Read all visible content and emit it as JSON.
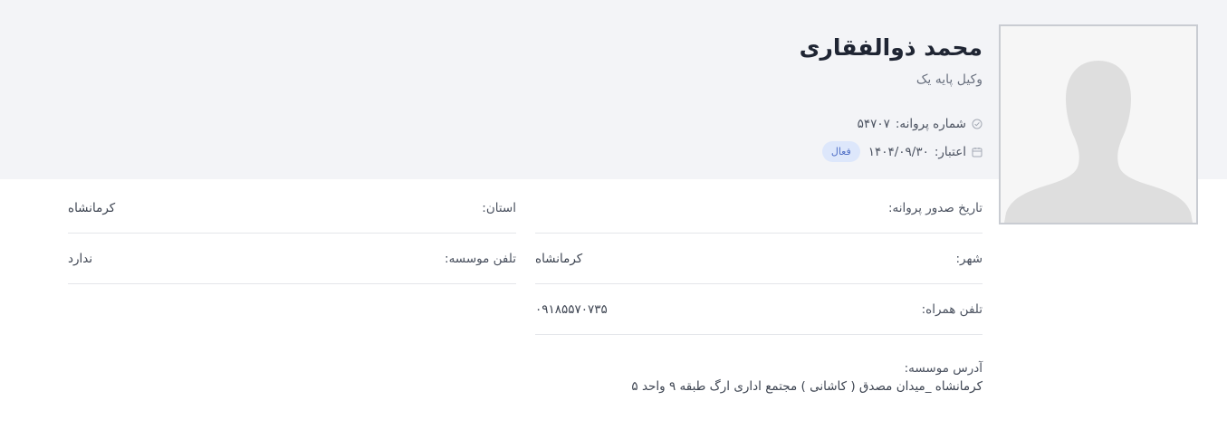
{
  "profile": {
    "name": "محمد ذوالفقاری",
    "title": "وکیل پایه یک",
    "license_label": "شماره پروانه:",
    "license_number": "۵۴۷۰۷",
    "validity_label": "اعتبار:",
    "validity_date": "۱۴۰۴/۰۹/۳۰",
    "status_badge": "فعال"
  },
  "fields": {
    "issue_date": {
      "label": "تاریخ صدور پروانه:",
      "value": ""
    },
    "province": {
      "label": "استان:",
      "value": "کرمانشاه"
    },
    "city": {
      "label": "شهر:",
      "value": "کرمانشاه"
    },
    "institute_phone": {
      "label": "تلفن موسسه:",
      "value": "ندارد"
    },
    "mobile": {
      "label": "تلفن همراه:",
      "value": "۰۹۱۸۵۵۷۰۷۳۵"
    },
    "institute_address": {
      "label": "آدرس موسسه:",
      "value": "کرمانشاه _میدان مصدق ( کاشانی ) مجتمع اداری ارگ طبقه ۹ واحد ۵"
    }
  },
  "icons": {
    "license": "check-circle-icon",
    "validity": "calendar-icon",
    "avatar": "person-silhouette-icon"
  },
  "colors": {
    "header_background": "#f3f4f7",
    "badge_background": "#dde7fb",
    "badge_text": "#4f6fc6"
  }
}
